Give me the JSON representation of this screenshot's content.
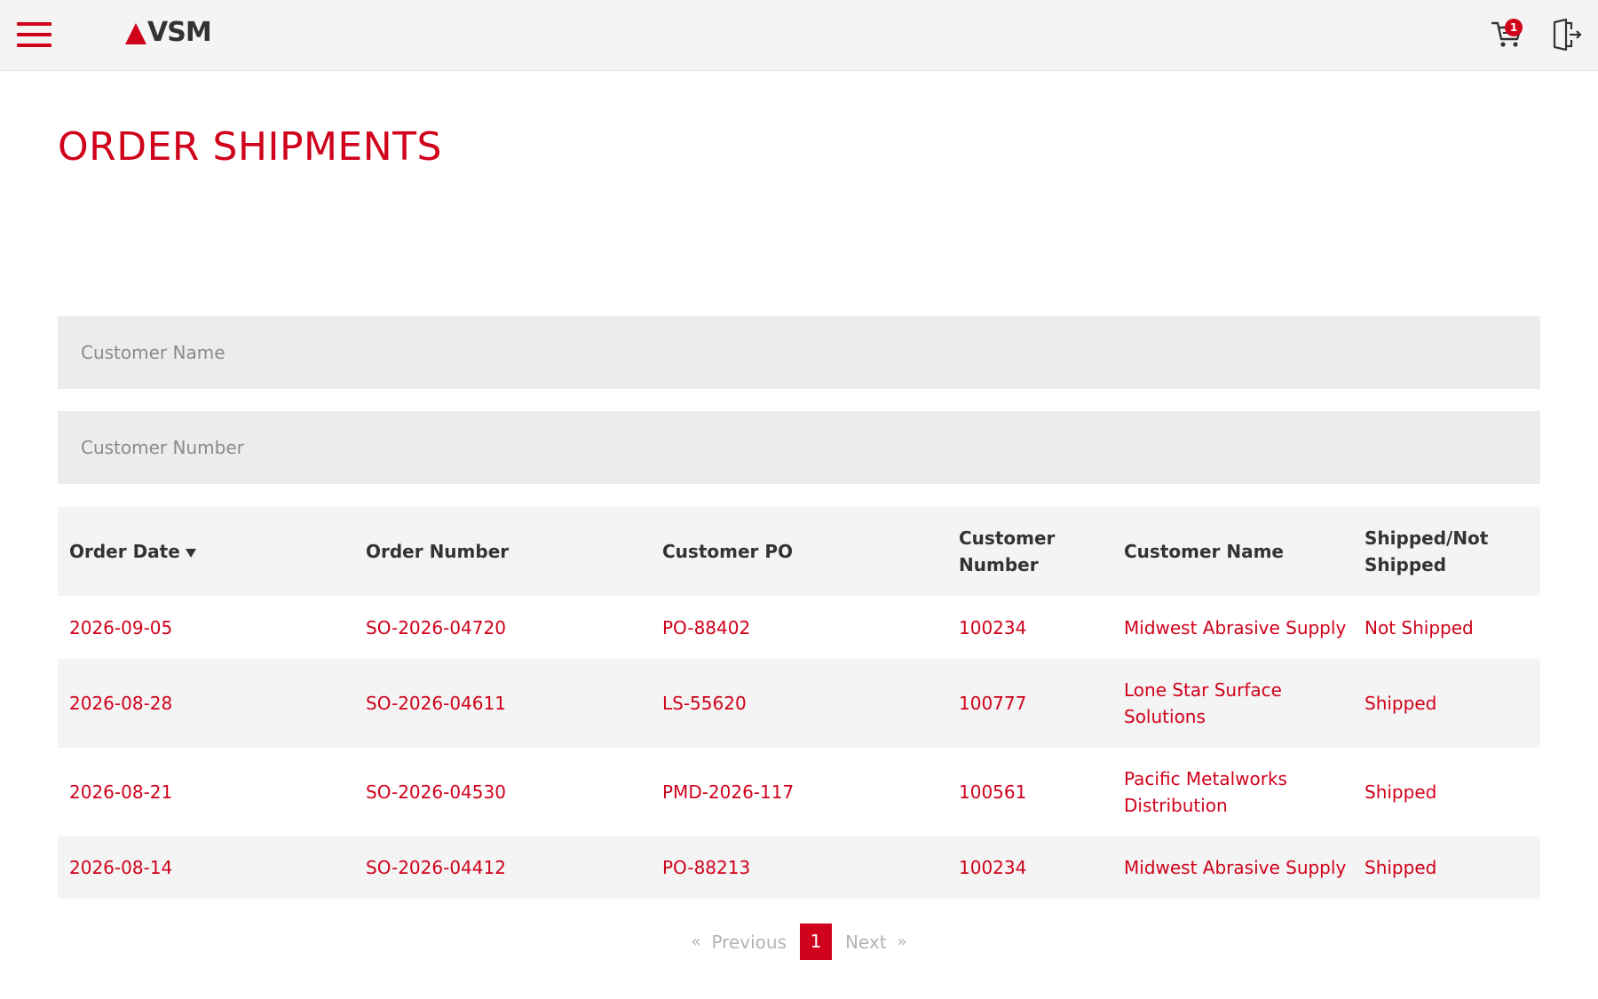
{
  "header": {
    "logo_text": "VSM",
    "cart_count": "1"
  },
  "page": {
    "title": "ORDER SHIPMENTS"
  },
  "filters": {
    "customer_name_placeholder": "Customer Name",
    "customer_number_placeholder": "Customer Number"
  },
  "table": {
    "headers": {
      "order_date": "Order Date",
      "order_number": "Order Number",
      "customer_po": "Customer PO",
      "customer_number": "Customer Number",
      "customer_name": "Customer Name",
      "shipped": "Shipped/Not Shipped"
    },
    "rows": [
      {
        "order_date": "2026-09-05",
        "order_number": "SO-2026-04720",
        "customer_po": "PO-88402",
        "customer_number": "100234",
        "customer_name": "Midwest Abrasive Supply",
        "shipped": "Not Shipped"
      },
      {
        "order_date": "2026-08-28",
        "order_number": "SO-2026-04611",
        "customer_po": "LS-55620",
        "customer_number": "100777",
        "customer_name": "Lone Star Surface Solutions",
        "shipped": "Shipped"
      },
      {
        "order_date": "2026-08-21",
        "order_number": "SO-2026-04530",
        "customer_po": "PMD-2026-117",
        "customer_number": "100561",
        "customer_name": "Pacific Metalworks Distribution",
        "shipped": "Shipped"
      },
      {
        "order_date": "2026-08-14",
        "order_number": "SO-2026-04412",
        "customer_po": "PO-88213",
        "customer_number": "100234",
        "customer_name": "Midwest Abrasive Supply",
        "shipped": "Shipped"
      }
    ]
  },
  "pagination": {
    "first_chevron": "«",
    "previous_label": "Previous",
    "current_page": "1",
    "next_label": "Next",
    "last_chevron": "»"
  },
  "colors": {
    "accent": "#d0021b",
    "header_bg": "#f4f4f4",
    "field_bg": "#ececec"
  },
  "icons": [
    "menu-icon",
    "cart-icon",
    "logout-icon",
    "sort-down-icon"
  ]
}
